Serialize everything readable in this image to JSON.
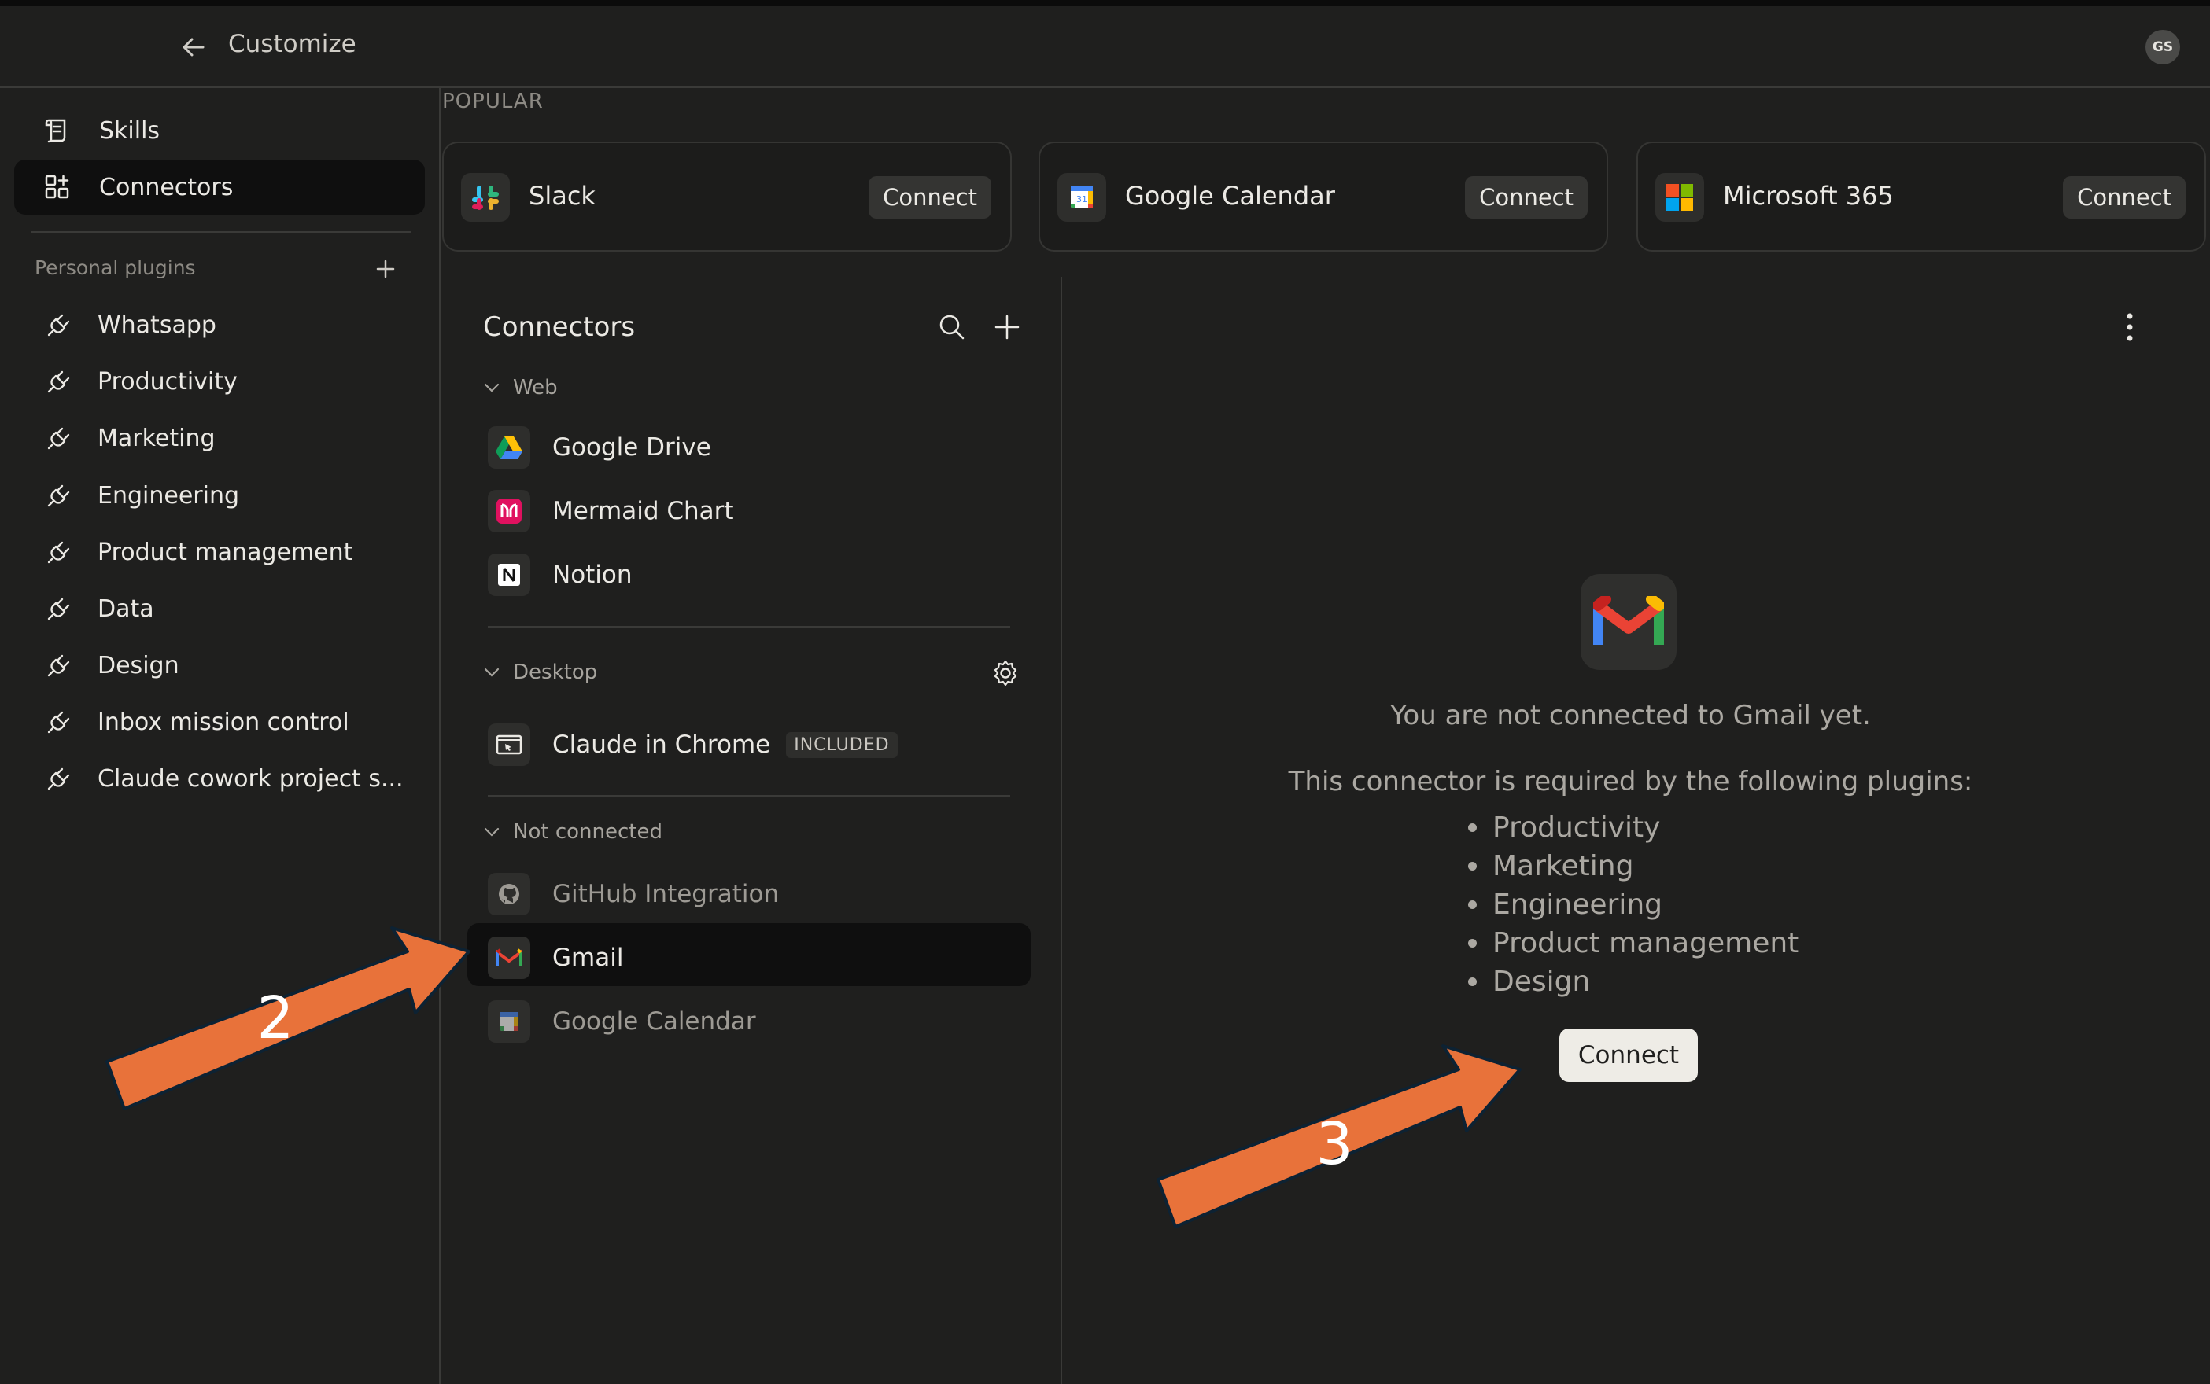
{
  "header": {
    "title": "Customize",
    "avatar_initials": "GS"
  },
  "sidebar": {
    "nav": [
      {
        "label": "Skills",
        "icon": "scroll-icon"
      },
      {
        "label": "Connectors",
        "icon": "grid-plus-icon",
        "active": true
      }
    ],
    "section_label": "Personal plugins",
    "plugins": [
      "Whatsapp",
      "Productivity",
      "Marketing",
      "Engineering",
      "Product management",
      "Data",
      "Design",
      "Inbox mission control",
      "Claude cowork project s..."
    ]
  },
  "popular": {
    "label": "POPULAR",
    "cards": [
      {
        "name": "Slack",
        "button": "Connect",
        "icon": "slack-icon"
      },
      {
        "name": "Google Calendar",
        "button": "Connect",
        "icon": "google-calendar-icon"
      },
      {
        "name": "Microsoft 365",
        "button": "Connect",
        "icon": "microsoft-icon"
      }
    ]
  },
  "connectors": {
    "title": "Connectors",
    "groups": [
      {
        "label": "Web",
        "items": [
          {
            "name": "Google Drive"
          },
          {
            "name": "Mermaid Chart"
          },
          {
            "name": "Notion"
          }
        ]
      },
      {
        "label": "Desktop",
        "items": [
          {
            "name": "Claude in Chrome",
            "badge": "INCLUDED"
          }
        ]
      },
      {
        "label": "Not connected",
        "items": [
          {
            "name": "GitHub Integration"
          },
          {
            "name": "Gmail",
            "selected": true
          },
          {
            "name": "Google Calendar"
          }
        ]
      }
    ]
  },
  "detail": {
    "not_connected_msg": "You are not connected to Gmail yet.",
    "required_msg": "This connector is required by the following plugins:",
    "plugins": [
      "Productivity",
      "Marketing",
      "Engineering",
      "Product management",
      "Design"
    ],
    "connect_label": "Connect"
  },
  "annotations": [
    {
      "label": "2"
    },
    {
      "label": "3"
    }
  ],
  "colors": {
    "arrow": "#e8723a",
    "arrow_outline": "#0d2233",
    "background": "#1f1f1e"
  }
}
